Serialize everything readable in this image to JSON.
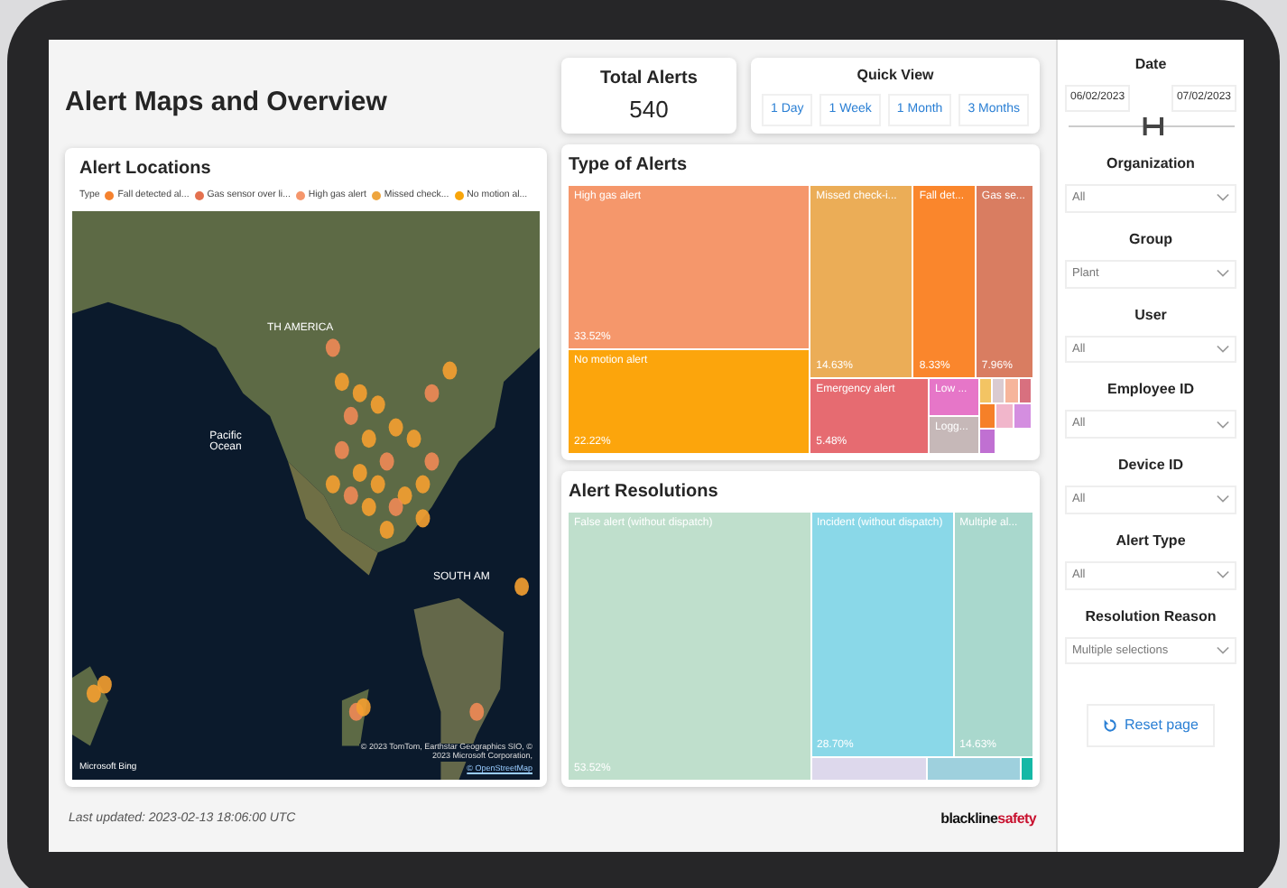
{
  "header": {
    "title": "Alert Maps and Overview"
  },
  "total_alerts": {
    "label": "Total Alerts",
    "value": "540"
  },
  "quick_view": {
    "title": "Quick View",
    "buttons": [
      "1 Day",
      "1 Week",
      "1 Month",
      "3 Months"
    ]
  },
  "alert_locations": {
    "title": "Alert Locations",
    "legend_title": "Type",
    "legend": [
      {
        "label": "Fall detected al...",
        "color": "#f5822f"
      },
      {
        "label": "Gas sensor over li...",
        "color": "#e4714f"
      },
      {
        "label": "High gas alert",
        "color": "#f5966b"
      },
      {
        "label": "Missed check...",
        "color": "#eea53e"
      },
      {
        "label": "No motion al...",
        "color": "#f8a50a"
      }
    ],
    "map_labels": [
      "TH AMERICA",
      "Pacific Ocean",
      "SOUTH AM"
    ],
    "attribution": "© 2023 TomTom, Earthstar Geographics SIO, © 2023 Microsoft Corporation,",
    "attribution_link": "© OpenStreetMap",
    "brand": "Microsoft Bing"
  },
  "type_of_alerts": {
    "title": "Type of Alerts",
    "cells": [
      {
        "label": "High gas alert",
        "percent": "33.52%",
        "color": "#f5976b"
      },
      {
        "label": "No motion alert",
        "percent": "22.22%",
        "color": "#fca50c"
      },
      {
        "label": "Missed check-i...",
        "percent": "14.63%",
        "color": "#ebad57"
      },
      {
        "label": "Fall det...",
        "percent": "8.33%",
        "color": "#fa862c"
      },
      {
        "label": "Gas se...",
        "percent": "7.96%",
        "color": "#d97d61"
      },
      {
        "label": "Emergency alert",
        "percent": "5.48%",
        "color": "#e66b71"
      },
      {
        "label": "Low ...",
        "color": "#e676c8"
      },
      {
        "label": "Logg...",
        "color": "#c6b8b8"
      }
    ],
    "minor_cells": [
      {
        "color": "#f3c463"
      },
      {
        "color": "#dacbd1"
      },
      {
        "color": "#f6b59b"
      },
      {
        "color": "#d8707f"
      },
      {
        "color": "#f68028"
      },
      {
        "color": "#f1b6cb"
      },
      {
        "color": "#d48ee0"
      },
      {
        "color": "#c070d2"
      }
    ]
  },
  "alert_resolutions": {
    "title": "Alert Resolutions",
    "cells": [
      {
        "label": "False alert (without dispatch)",
        "percent": "53.52%",
        "color": "#bfdfcc"
      },
      {
        "label": "Incident (without dispatch)",
        "percent": "28.70%",
        "color": "#8ad8e8"
      },
      {
        "label": "Multiple al...",
        "percent": "14.63%",
        "color": "#a9d8cd"
      }
    ],
    "minor_cells": [
      {
        "color": "#ddd8ec"
      },
      {
        "color": "#9ed0dd"
      },
      {
        "color": "#16b8a6"
      }
    ]
  },
  "footer": {
    "last_updated": "Last updated: 2023-02-13 18:06:00 UTC",
    "logo_dark": "blackline",
    "logo_accent": "safety"
  },
  "filters": {
    "date": {
      "label": "Date",
      "from": "06/02/2023",
      "to": "07/02/2023",
      "slider_thumbs": [
        {
          "level": 0.46
        },
        {
          "level": 0.56
        }
      ]
    },
    "dropdowns": [
      {
        "label": "Organization",
        "value": "All"
      },
      {
        "label": "Group",
        "value": "Plant"
      },
      {
        "label": "User",
        "value": "All"
      },
      {
        "label": "Employee ID",
        "value": "All"
      },
      {
        "label": "Device ID",
        "value": "All"
      },
      {
        "label": "Alert Type",
        "value": "All"
      },
      {
        "label": "Resolution Reason",
        "value": "Multiple selections"
      }
    ],
    "reset_button": "Reset page"
  }
}
